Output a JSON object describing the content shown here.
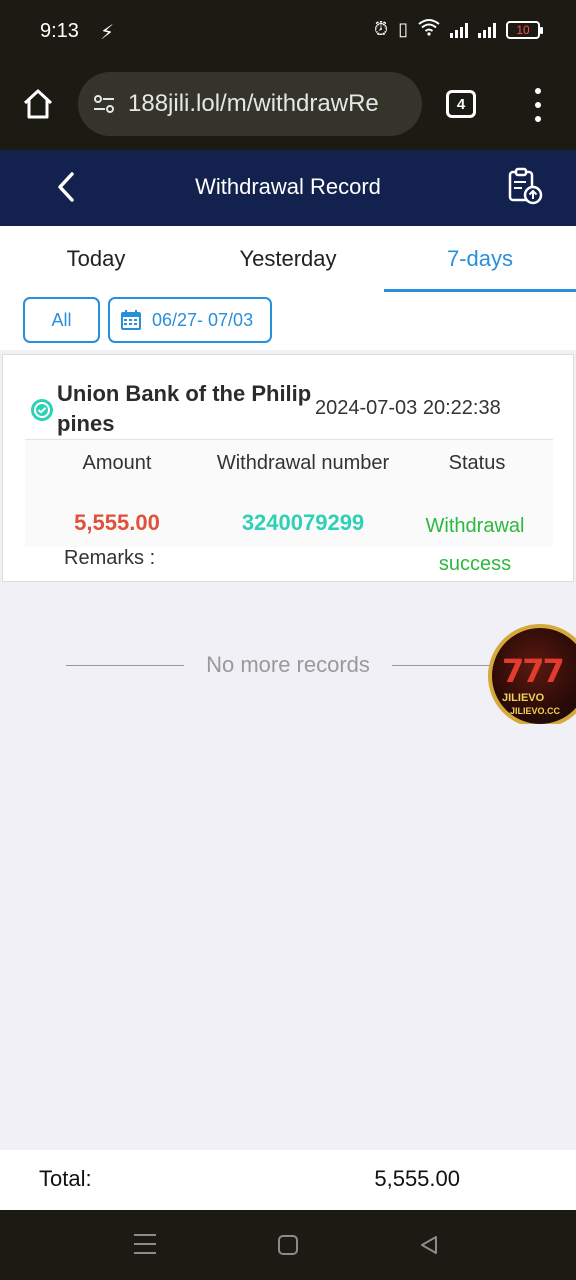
{
  "status_bar": {
    "time": "9:13",
    "battery": "10"
  },
  "browser": {
    "url": "188jili.lol/m/withdrawRe",
    "tab_count": "4"
  },
  "header": {
    "title": "Withdrawal Record"
  },
  "tabs": [
    {
      "label": "Today",
      "active": false
    },
    {
      "label": "Yesterday",
      "active": false
    },
    {
      "label": "7-days",
      "active": true
    }
  ],
  "filters": {
    "all_label": "All",
    "date_range": "06/27- 07/03"
  },
  "record": {
    "bank": "Union Bank of the Philippines",
    "datetime": "2024-07-03 20:22:38",
    "headers": {
      "amount": "Amount",
      "number": "Withdrawal number",
      "status": "Status"
    },
    "amount": "5,555.00",
    "number": "3240079299",
    "status": "Withdrawal success",
    "remarks_label": "Remarks"
  },
  "no_more": "No more records",
  "badge": {
    "numbers": "777",
    "brand": "JILIEVO",
    "site": "JILIEVO.CC"
  },
  "total": {
    "label": "Total:",
    "value": "5,555.00"
  },
  "colors": {
    "header_bg": "#13214e",
    "accent": "#2a8fdb",
    "amount": "#e0503a",
    "number": "#2fd0b6",
    "success": "#2bba3f"
  }
}
